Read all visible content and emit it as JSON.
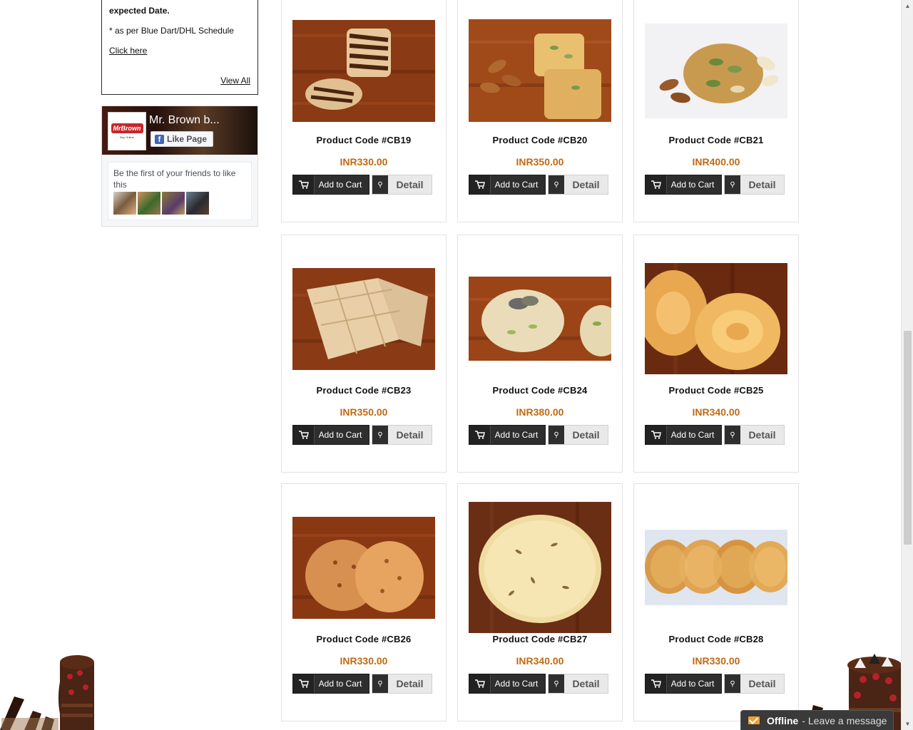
{
  "sidebar": {
    "shipping_box": {
      "title": "expected Date.",
      "note": "* as per Blue Dart/DHL Schedule",
      "link": "Click here",
      "view_all": "View All"
    },
    "facebook": {
      "page_name": "Mr. Brown b...",
      "like_button": "Like Page",
      "friends_text": "Be the first of your friends to like this",
      "logo_text": "MrBrown",
      "logo_subtext": "Buy Online"
    }
  },
  "products": [
    {
      "code": "Product Code #CB19",
      "price": "INR330.00",
      "add_to_cart": "Add to Cart",
      "detail": "Detail",
      "image": "zebra-cookie"
    },
    {
      "code": "Product Code #CB20",
      "price": "INR350.00",
      "add_to_cart": "Add to Cart",
      "detail": "Detail",
      "image": "almond-pista-cookie"
    },
    {
      "code": "Product Code #CB21",
      "price": "INR400.00",
      "add_to_cart": "Add to Cart",
      "detail": "Detail",
      "image": "nut-cookie"
    },
    {
      "code": "Product Code #CB23",
      "price": "INR350.00",
      "add_to_cart": "Add to Cart",
      "detail": "Detail",
      "image": "diamond-cookie"
    },
    {
      "code": "Product Code #CB24",
      "price": "INR380.00",
      "add_to_cart": "Add to Cart",
      "detail": "Detail",
      "image": "pista-cookie"
    },
    {
      "code": "Product Code #CB25",
      "price": "INR340.00",
      "add_to_cart": "Add to Cart",
      "detail": "Detail",
      "image": "swirl-cookie"
    },
    {
      "code": "Product Code #CB26",
      "price": "INR330.00",
      "add_to_cart": "Add to Cart",
      "detail": "Detail",
      "image": "round-cookie"
    },
    {
      "code": "Product Code #CB27",
      "price": "INR340.00",
      "add_to_cart": "Add to Cart",
      "detail": "Detail",
      "image": "jeera-cookie"
    },
    {
      "code": "Product Code #CB28",
      "price": "INR330.00",
      "add_to_cart": "Add to Cart",
      "detail": "Detail",
      "image": "coconut-cookies"
    }
  ],
  "chat": {
    "status": "Offline",
    "message": "- Leave a message",
    "icon": "mail-icon"
  },
  "colors": {
    "price": "#c06a12",
    "button_dark": "#2e2e2e",
    "button_light": "#e9e9e9"
  }
}
